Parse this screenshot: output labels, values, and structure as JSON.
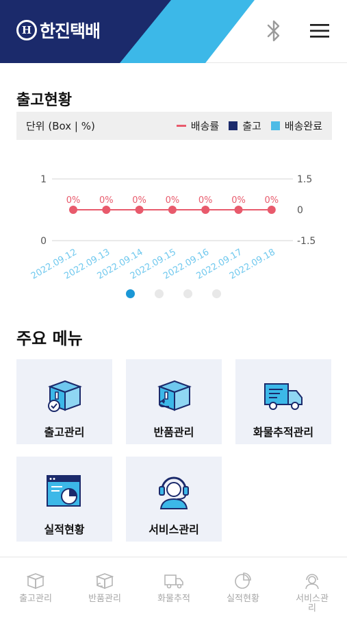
{
  "header": {
    "logo_mark": "H",
    "logo_text": "한진택배",
    "colors": {
      "navy": "#1b2a6b",
      "sky": "#3cb8e8"
    }
  },
  "shipment_status": {
    "title": "출고현황",
    "unit_label": "단위 (Box | %)",
    "legend": [
      {
        "label": "배송률",
        "kind": "line",
        "color": "#e85a6c"
      },
      {
        "label": "출고",
        "kind": "box",
        "color": "#1b2a6b"
      },
      {
        "label": "배송완료",
        "kind": "box",
        "color": "#4dbbe6"
      }
    ]
  },
  "chart_data": {
    "type": "line",
    "categories": [
      "2022.09.12",
      "2022.09.13",
      "2022.09.14",
      "2022.09.15",
      "2022.09.16",
      "2022.09.17",
      "2022.09.18"
    ],
    "series": [
      {
        "name": "배송률",
        "values": [
          0,
          0,
          0,
          0,
          0,
          0,
          0
        ],
        "labels": [
          "0%",
          "0%",
          "0%",
          "0%",
          "0%",
          "0%",
          "0%"
        ],
        "axis": "right"
      },
      {
        "name": "출고",
        "values": [
          0,
          0,
          0,
          0,
          0,
          0,
          0
        ],
        "axis": "left"
      },
      {
        "name": "배송완료",
        "values": [
          0,
          0,
          0,
          0,
          0,
          0,
          0
        ],
        "axis": "left"
      }
    ],
    "left_axis": {
      "ylim": [
        0,
        1
      ],
      "ticks": [
        "1",
        "0"
      ]
    },
    "right_axis": {
      "ylim": [
        -1.5,
        1.5
      ],
      "ticks": [
        "1.5",
        "0",
        "-1.5"
      ]
    },
    "grid": true
  },
  "pager": {
    "count": 4,
    "active": 0
  },
  "main_menu": {
    "title": "주요 메뉴",
    "items": [
      {
        "label": "출고관리",
        "icon": "box-check-icon"
      },
      {
        "label": "반품관리",
        "icon": "box-return-icon"
      },
      {
        "label": "화물추적관리",
        "icon": "truck-icon"
      },
      {
        "label": "실적현황",
        "icon": "report-chart-icon"
      },
      {
        "label": "서비스관리",
        "icon": "headset-icon"
      }
    ]
  },
  "bottom_nav": {
    "items": [
      {
        "label": "출고관리",
        "icon": "box-icon"
      },
      {
        "label": "반품관리",
        "icon": "box-return-icon"
      },
      {
        "label": "화물추적",
        "icon": "truck-icon"
      },
      {
        "label": "실적현황",
        "icon": "pie-chart-icon"
      },
      {
        "label": "서비스관리",
        "icon": "headset-icon"
      }
    ]
  }
}
